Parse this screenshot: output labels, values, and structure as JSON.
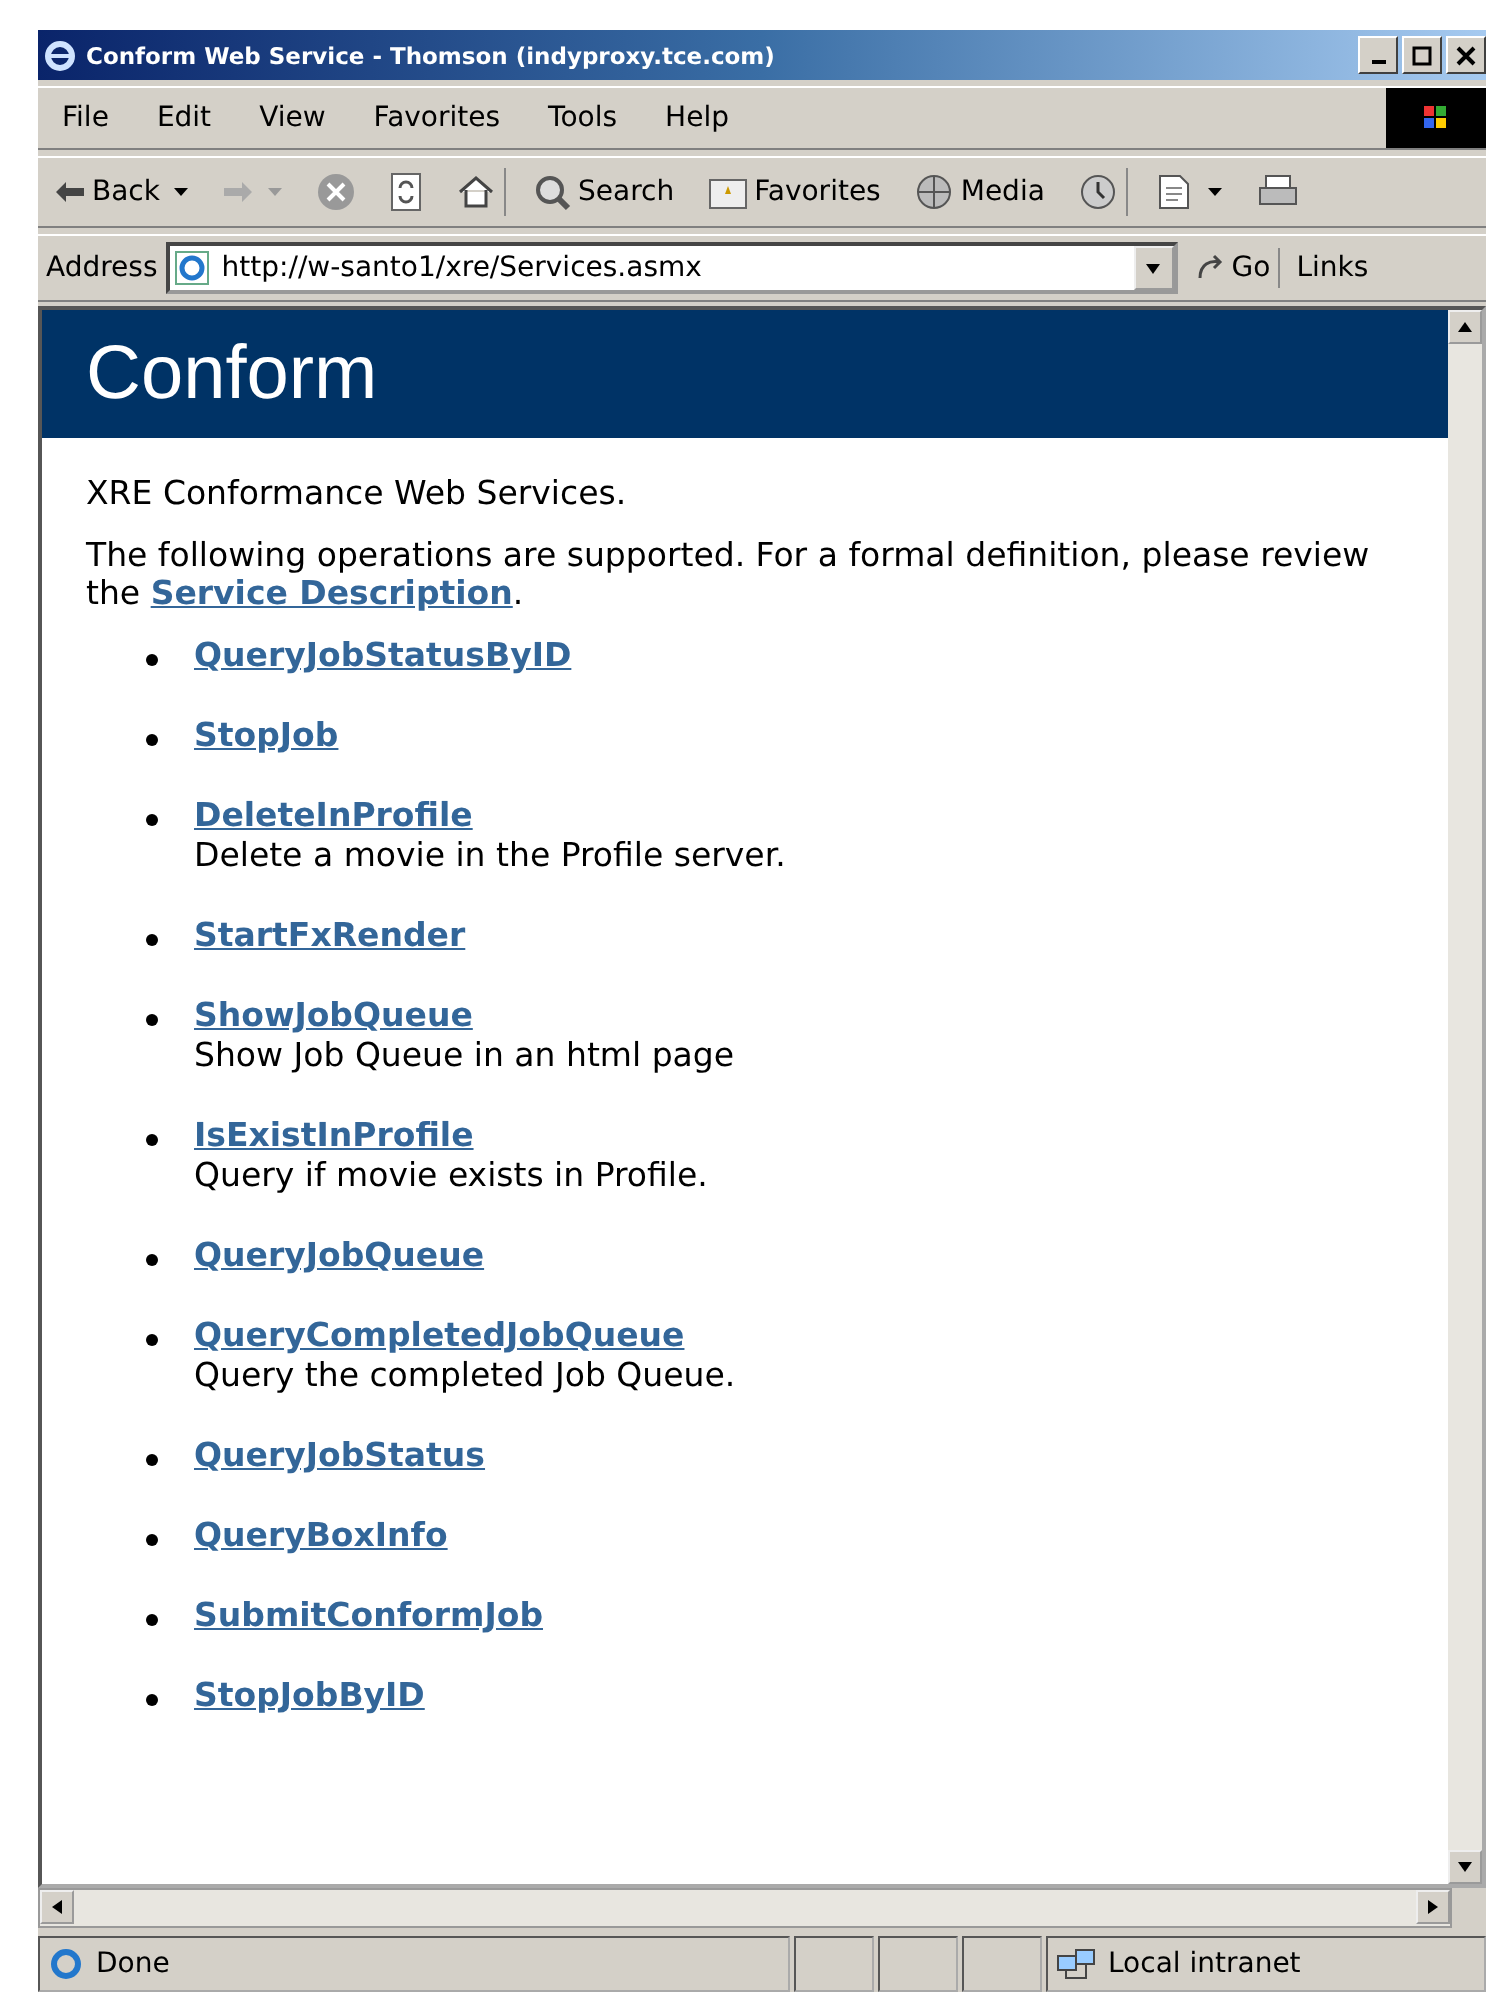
{
  "window": {
    "title": "Conform Web Service - Thomson (indyproxy.tce.com)"
  },
  "menu": [
    "File",
    "Edit",
    "View",
    "Favorites",
    "Tools",
    "Help"
  ],
  "toolbar": [
    {
      "kind": "back",
      "label": "Back"
    },
    {
      "kind": "forward"
    },
    {
      "kind": "stop"
    },
    {
      "kind": "refresh"
    },
    {
      "kind": "home"
    },
    {
      "kind": "search",
      "label": "Search"
    },
    {
      "kind": "favorites",
      "label": "Favorites"
    },
    {
      "kind": "media",
      "label": "Media"
    },
    {
      "kind": "history"
    },
    {
      "kind": "edit"
    },
    {
      "kind": "print"
    }
  ],
  "address": {
    "label": "Address",
    "value": "http://w-santo1/xre/Services.asmx",
    "go": "Go",
    "links": "Links"
  },
  "page": {
    "heading": "Conform",
    "intro": "XRE Conformance Web Services.",
    "text": "The following operations are supported. For a formal definition, please review the ",
    "link": "Service Description",
    "after": ".",
    "operations": [
      {
        "name": "QueryJobStatusByID"
      },
      {
        "name": "StopJob"
      },
      {
        "name": "DeleteInProfile",
        "description": "Delete a movie in the Profile server."
      },
      {
        "name": "StartFxRender"
      },
      {
        "name": "ShowJobQueue",
        "description": "Show Job Queue in an html page"
      },
      {
        "name": "IsExistInProfile",
        "description": "Query if movie exists in Profile."
      },
      {
        "name": "QueryJobQueue"
      },
      {
        "name": "QueryCompletedJobQueue",
        "description": "Query the completed Job Queue."
      },
      {
        "name": "QueryJobStatus"
      },
      {
        "name": "QueryBoxInfo"
      },
      {
        "name": "SubmitConformJob"
      },
      {
        "name": "StopJobByID"
      }
    ]
  },
  "status_bar": {
    "status": "Done",
    "zone": "Local intranet"
  }
}
